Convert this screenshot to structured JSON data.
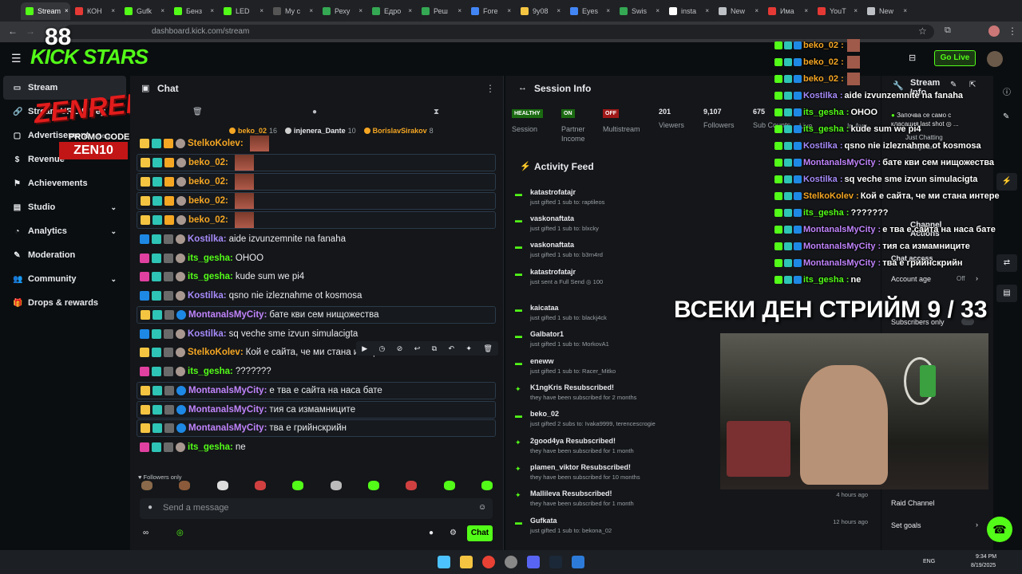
{
  "browser": {
    "tabs": [
      "Stream",
      "КОН",
      "Gufk",
      "Бенз",
      "LED",
      "Му с",
      "Реху",
      "Едро",
      "Реш",
      "Fore",
      "9y08",
      "Eyes",
      "Swis",
      "insta",
      "New",
      "Има",
      "YouT",
      "New"
    ],
    "url": "dashboard.kick.com/stream"
  },
  "overlay": {
    "logo_text": "KICK STARS",
    "brand": "ZENREMASTA",
    "promo_label": "PROMO CODE",
    "promo_code": "ZEN10",
    "banner": "ВСЕКИ ДЕН СТРИЙМ 9 / 33"
  },
  "header": {
    "go_live": "Go Live"
  },
  "sidebar": {
    "items": [
      {
        "label": "Stream"
      },
      {
        "label": "Stream URL & Key"
      },
      {
        "label": "Advertisement",
        "tag": "Beta"
      },
      {
        "label": "Revenue"
      },
      {
        "label": "Achievements"
      },
      {
        "label": "Studio"
      },
      {
        "label": "Analytics"
      },
      {
        "label": "Moderation"
      },
      {
        "label": "Community"
      },
      {
        "label": "Drops & rewards"
      }
    ]
  },
  "chat": {
    "title": "Chat",
    "top_gifters": [
      {
        "name": "beko_02",
        "count": "16"
      },
      {
        "name": "injenera_Dante",
        "count": "10"
      },
      {
        "name": "BorislavSirakov",
        "count": "8"
      }
    ],
    "messages": [
      {
        "user": "StelkoKolev:",
        "text": "",
        "color": "#f5a623"
      },
      {
        "user": "beko_02:",
        "text": "",
        "color": "#f5a623"
      },
      {
        "user": "beko_02:",
        "text": "",
        "color": "#f5a623"
      },
      {
        "user": "beko_02:",
        "text": "",
        "color": "#f5a623"
      },
      {
        "user": "beko_02:",
        "text": "",
        "color": "#f5a623"
      },
      {
        "user": "Kostilka:",
        "text": " aide izvunzemnite na fanaha",
        "color": "#a78bfa"
      },
      {
        "user": "its_gesha:",
        "text": " OHOO",
        "color": "#53fc18"
      },
      {
        "user": "its_gesha:",
        "text": " kude sum we pi4",
        "color": "#53fc18"
      },
      {
        "user": "Kostilka:",
        "text": " qsno nie izleznahme ot kosmosa",
        "color": "#a78bfa"
      },
      {
        "user": "MontanalsMyCity:",
        "text": " бате кви сем нищожества",
        "color": "#c084fc"
      },
      {
        "user": "Kostilka:",
        "text": " sq veche sme izvun simulacigta",
        "color": "#a78bfa"
      },
      {
        "user": "StelkoKolev:",
        "text": " Кой е сайта, че ми стана интересно",
        "color": "#f5a623"
      },
      {
        "user": "its_gesha:",
        "text": " ???????",
        "color": "#53fc18"
      },
      {
        "user": "MontanalsMyCity:",
        "text": " е тва е сайта на наса бате",
        "color": "#c084fc"
      },
      {
        "user": "MontanalsMyCity:",
        "text": " тия са измамниците",
        "color": "#c084fc"
      },
      {
        "user": "MontanalsMyCity:",
        "text": " тва е грийнскрийн",
        "color": "#c084fc"
      },
      {
        "user": "its_gesha:",
        "text": " ne",
        "color": "#53fc18"
      }
    ],
    "followers_only": "Followers only",
    "input_placeholder": "Send a message",
    "send": "Chat"
  },
  "session": {
    "title": "Session Info",
    "stats": [
      {
        "badge": "HEALTHY",
        "label": "Session"
      },
      {
        "badge": "ON",
        "label": "Partner Income"
      },
      {
        "badge": "OFF",
        "label": "Multistream"
      },
      {
        "value": "201",
        "label": "Viewers"
      },
      {
        "value": "9,107",
        "label": "Followers"
      },
      {
        "value": "675",
        "label": "Sub Counts"
      },
      {
        "label": "Live"
      },
      {
        "label": "In Avg."
      }
    ],
    "feed_title": "Activity Feed",
    "feed": [
      {
        "title": "katastrofatajr",
        "sub": "just gifted 1 sub to: raptileos",
        "time": ""
      },
      {
        "title": "vaskonaftata",
        "sub": "just gifted 1 sub to: blxcky",
        "time": ""
      },
      {
        "title": "vaskonaftata",
        "sub": "just gifted 1 sub to: b3rn4rd",
        "time": ""
      },
      {
        "title": "katastrofatajr",
        "sub": "just sent a Full Send  ◎ 100",
        "time": ""
      },
      {
        "title": "kaicataa",
        "sub": "just gifted 1 sub to: blackj4ck",
        "time": ""
      },
      {
        "title": "Galbator1",
        "sub": "just gifted 1 sub to: MorkovA1",
        "time": ""
      },
      {
        "title": "eneww",
        "sub": "just gifted 1 sub to: Racer_Mitko",
        "time": ""
      },
      {
        "title": "K1ngKris Resubscribed!",
        "sub": "they have been subscribed for 2 months",
        "time": ""
      },
      {
        "title": "beko_02",
        "sub": "just gifted 2 subs to: Ivaka9999, terencescrogie",
        "time": ""
      },
      {
        "title": "2good4ya Resubscribed!",
        "sub": "they have been subscribed for 1 month",
        "time": ""
      },
      {
        "title": "plamen_viktor Resubscribed!",
        "sub": "they have been subscribed for 10 months",
        "time": ""
      },
      {
        "title": "Mallileva Resubscribed!",
        "sub": "they have been subscribed for 1 month",
        "time": "4 hours ago"
      },
      {
        "title": "Gufkata",
        "sub": "just gifted 1 sub to: bekona_02",
        "time": "12 hours ago"
      }
    ]
  },
  "stream_panel": {
    "title": "Stream Info",
    "just_chatting": "Just Chatting",
    "channel_actions": "Channel Actions",
    "chat_access": "Chat access",
    "account_age": "Account age",
    "account_age_value": "Off",
    "subscribers_only": "Subscribers only",
    "raid": "Raid Channel",
    "goals": "Set goals",
    "bulgarian": "Bulgarian"
  },
  "overlay_chat": [
    {
      "user": "beko_02 :",
      "text": "",
      "color": "#f5a623"
    },
    {
      "user": "beko_02 :",
      "text": "",
      "color": "#f5a623"
    },
    {
      "user": "beko_02 :",
      "text": "",
      "color": "#f5a623"
    },
    {
      "user": "Kostilka :",
      "text": " aide izvunzemnite na fanaha",
      "color": "#a78bfa"
    },
    {
      "user": "its_gesha :",
      "text": " OHOO",
      "color": "#53fc18"
    },
    {
      "user": "its_gesha :",
      "text": " kude sum we pi4",
      "color": "#53fc18"
    },
    {
      "user": "Kostilka :",
      "text": " qsno nie izleznahme ot kosmosa",
      "color": "#a78bfa"
    },
    {
      "user": "MontanalsMyCity :",
      "text": " бате кви сем нищожества",
      "color": "#c084fc"
    },
    {
      "user": "Kostilka :",
      "text": " sq veche sme izvun simulacigta",
      "color": "#a78bfa"
    },
    {
      "user": "StelkoKolev :",
      "text": " Кой е сайта, че ми стана интере",
      "color": "#f5a623"
    },
    {
      "user": "its_gesha :",
      "text": " ???????",
      "color": "#53fc18"
    },
    {
      "user": "MontanalsMyCity :",
      "text": " е тва е сайта на наса бате",
      "color": "#c084fc"
    },
    {
      "user": "MontanalsMyCity :",
      "text": " тия са измамниците",
      "color": "#c084fc"
    },
    {
      "user": "MontanalsMyCity :",
      "text": " тва е грийнскрийн",
      "color": "#c084fc"
    },
    {
      "user": "its_gesha :",
      "text": " ne",
      "color": "#53fc18"
    }
  ],
  "overlay_side": {
    "chat_msg": "Започва се само с класация last shot ◎ ..."
  },
  "taskbar": {
    "lang": "ENG",
    "time": "9:34 PM",
    "date": "8/19/2025"
  }
}
